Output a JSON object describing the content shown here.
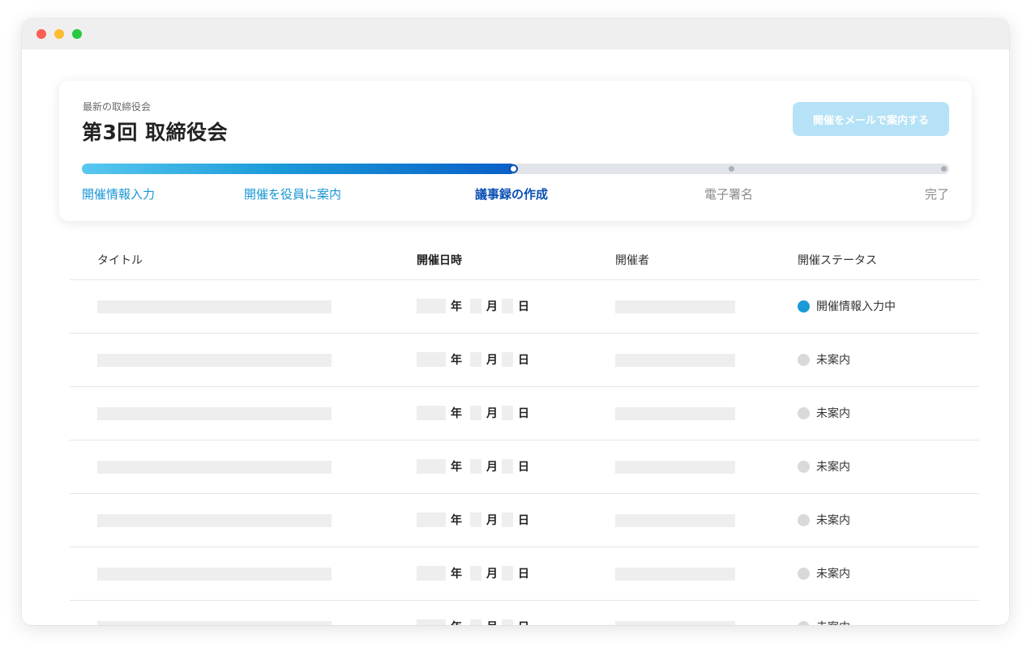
{
  "card": {
    "subtitle": "最新の取締役会",
    "title": "第3回 取締役会",
    "notify_button": "開催をメールで案内する"
  },
  "progress": {
    "fraction": 0.5,
    "steps": [
      {
        "label": "開催情報入力",
        "state": "done"
      },
      {
        "label": "開催を役員に案内",
        "state": "done"
      },
      {
        "label": "議事録の作成",
        "state": "current"
      },
      {
        "label": "電子署名",
        "state": "todo"
      },
      {
        "label": "完了",
        "state": "todo"
      }
    ]
  },
  "table": {
    "headers": {
      "title": "タイトル",
      "date": "開催日時",
      "host": "開催者",
      "status": "開催ステータス"
    },
    "date_units": {
      "year": "年",
      "month": "月",
      "day": "日"
    },
    "rows": [
      {
        "status": "開催情報入力中",
        "status_color": "#1a9ad6"
      },
      {
        "status": "未案内",
        "status_color": "#d9d9d9"
      },
      {
        "status": "未案内",
        "status_color": "#d9d9d9"
      },
      {
        "status": "未案内",
        "status_color": "#d9d9d9"
      },
      {
        "status": "未案内",
        "status_color": "#d9d9d9"
      },
      {
        "status": "未案内",
        "status_color": "#d9d9d9"
      },
      {
        "status": "未案内",
        "status_color": "#d9d9d9"
      }
    ]
  },
  "colors": {
    "accent": "#1795d4",
    "current_step": "#0b4fb3",
    "button_bg": "#b5e2f6"
  }
}
